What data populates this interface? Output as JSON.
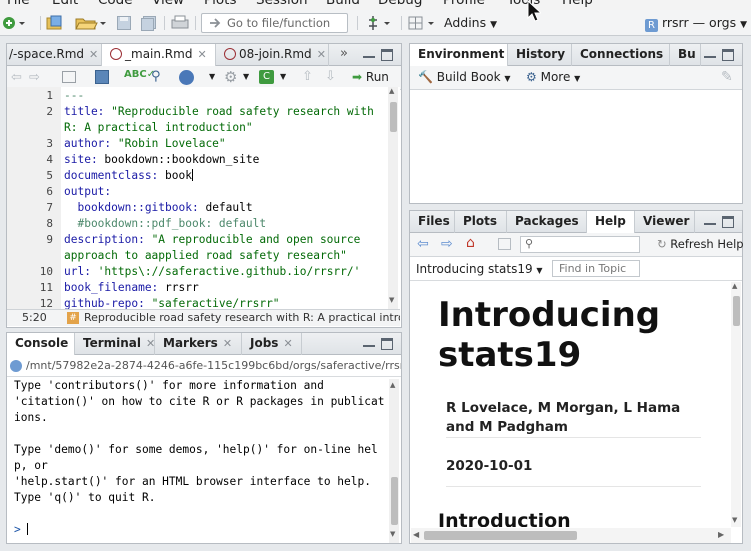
{
  "menu": [
    "File",
    "Edit",
    "Code",
    "View",
    "Plots",
    "Session",
    "Build",
    "Debug",
    "Profile",
    "Tools",
    "Help"
  ],
  "toolbar": {
    "goto_placeholder": "Go to file/function",
    "addins_label": "Addins",
    "project_label": "rrsrr — orgs"
  },
  "editor": {
    "tabs": [
      "/-space.Rmd",
      "_main.Rmd",
      "08-join.Rmd"
    ],
    "run_label": "Run",
    "lines": [
      {
        "n": "1",
        "parts": [
          [
            "c",
            "---"
          ]
        ]
      },
      {
        "n": "2",
        "parts": [
          [
            "k",
            "title: "
          ],
          [
            "s",
            "\"Reproducible road safety research with"
          ]
        ]
      },
      {
        "n": "",
        "parts": [
          [
            "s",
            "R: A practical introduction\""
          ]
        ]
      },
      {
        "n": "3",
        "parts": [
          [
            "k",
            "author: "
          ],
          [
            "s",
            "\"Robin Lovelace\""
          ]
        ]
      },
      {
        "n": "4",
        "parts": [
          [
            "k",
            "site: "
          ],
          [
            "",
            "bookdown::bookdown_site"
          ]
        ]
      },
      {
        "n": "5",
        "parts": [
          [
            "k",
            "documentclass: "
          ],
          [
            "",
            "book"
          ]
        ]
      },
      {
        "n": "6",
        "parts": [
          [
            "k",
            "output:"
          ]
        ]
      },
      {
        "n": "7",
        "parts": [
          [
            "k",
            "  bookdown::gitbook: "
          ],
          [
            "",
            "default"
          ]
        ]
      },
      {
        "n": "8",
        "parts": [
          [
            "c",
            "  #bookdown::pdf_book: default"
          ]
        ]
      },
      {
        "n": "9",
        "parts": [
          [
            "k",
            "description: "
          ],
          [
            "s",
            "\"A reproducible and open source"
          ]
        ]
      },
      {
        "n": "",
        "parts": [
          [
            "s",
            "approach to aapplied road safety research\""
          ]
        ]
      },
      {
        "n": "10",
        "parts": [
          [
            "k",
            "url: "
          ],
          [
            "s",
            "'https\\://saferactive.github.io/rrsrr/'"
          ]
        ]
      },
      {
        "n": "11",
        "parts": [
          [
            "k",
            "book_filename: "
          ],
          [
            "",
            "rrsrr"
          ]
        ]
      },
      {
        "n": "12",
        "parts": [
          [
            "k",
            "github-repo: "
          ],
          [
            "s",
            "\"saferactive/rrsrr\""
          ]
        ]
      }
    ],
    "cursor_pos": "5:20",
    "section_label": "Reproducible road safety research with R: A practical intro"
  },
  "console": {
    "tabs": [
      "Console",
      "Terminal",
      "Markers",
      "Jobs"
    ],
    "path": "/mnt/57982e2a-2874-4246-a6fe-115c199bc6bd/orgs/saferactive/rrsrr/",
    "lines": [
      "Type 'contributors()' for more information and",
      "'citation()' on how to cite R or R packages in publicat",
      "ions.",
      "",
      "Type 'demo()' for some demos, 'help()' for on-line hel",
      "p, or",
      "'help.start()' for an HTML browser interface to help.",
      "Type 'q()' to quit R.",
      "",
      ""
    ],
    "prompt": ">"
  },
  "env": {
    "tabs": [
      "Environment",
      "History",
      "Connections",
      "Bu"
    ],
    "build_book_label": "Build Book",
    "more_label": "More"
  },
  "help": {
    "tabs": [
      "Files",
      "Plots",
      "Packages",
      "Help",
      "Viewer"
    ],
    "refresh_label": "Refresh Help",
    "topic_label": "Introducing stats19",
    "find_placeholder": "Find in Topic",
    "doc_title_1": "Introducing",
    "doc_title_2": "stats19",
    "authors": "R Lovelace, M Morgan, L Hama and M Padgham",
    "date": "2020-10-01",
    "section": "Introduction"
  }
}
